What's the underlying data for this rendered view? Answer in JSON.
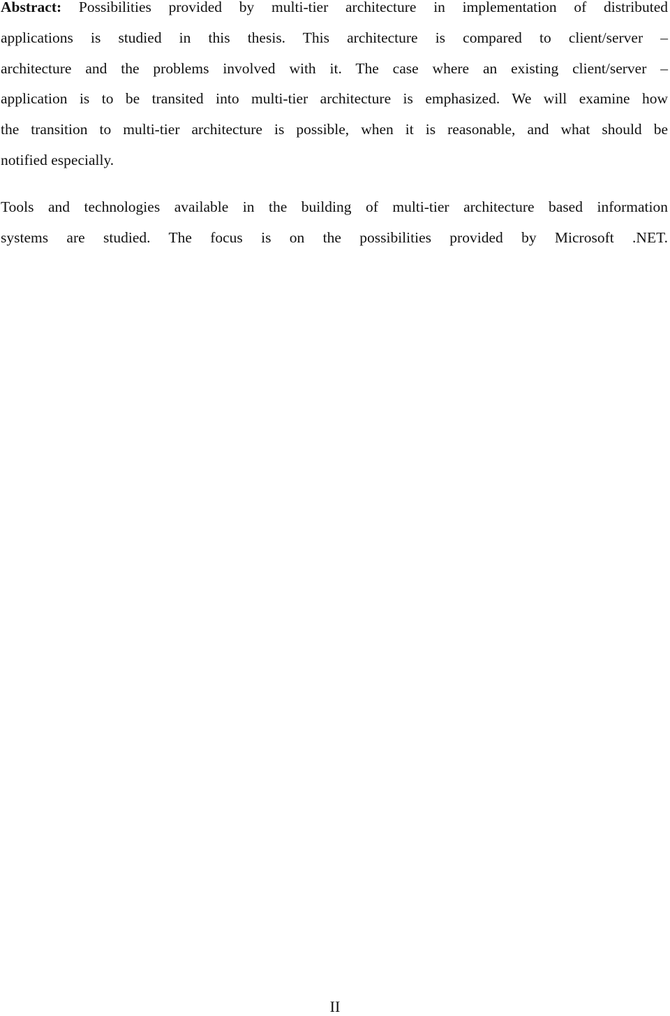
{
  "document": {
    "abstract": {
      "label": "Abstract:",
      "lines": [
        " Possibilities provided by multi-tier architecture in implementation of distributed",
        "applications is studied in this thesis. This architecture is compared to client/server –",
        "architecture and the problems involved with it. The case where an existing client/server –",
        "application is to be transited into multi-tier architecture is emphasized. We will examine how",
        "the transition to multi-tier architecture is possible, when it is reasonable, and what should be",
        "notified especially."
      ]
    },
    "tools_paragraph": {
      "lines": [
        "Tools and technologies available in the building of multi-tier architecture based information",
        "systems are studied. The focus is on the possibilities provided by Microsoft .NET."
      ]
    },
    "page_number": "II"
  }
}
